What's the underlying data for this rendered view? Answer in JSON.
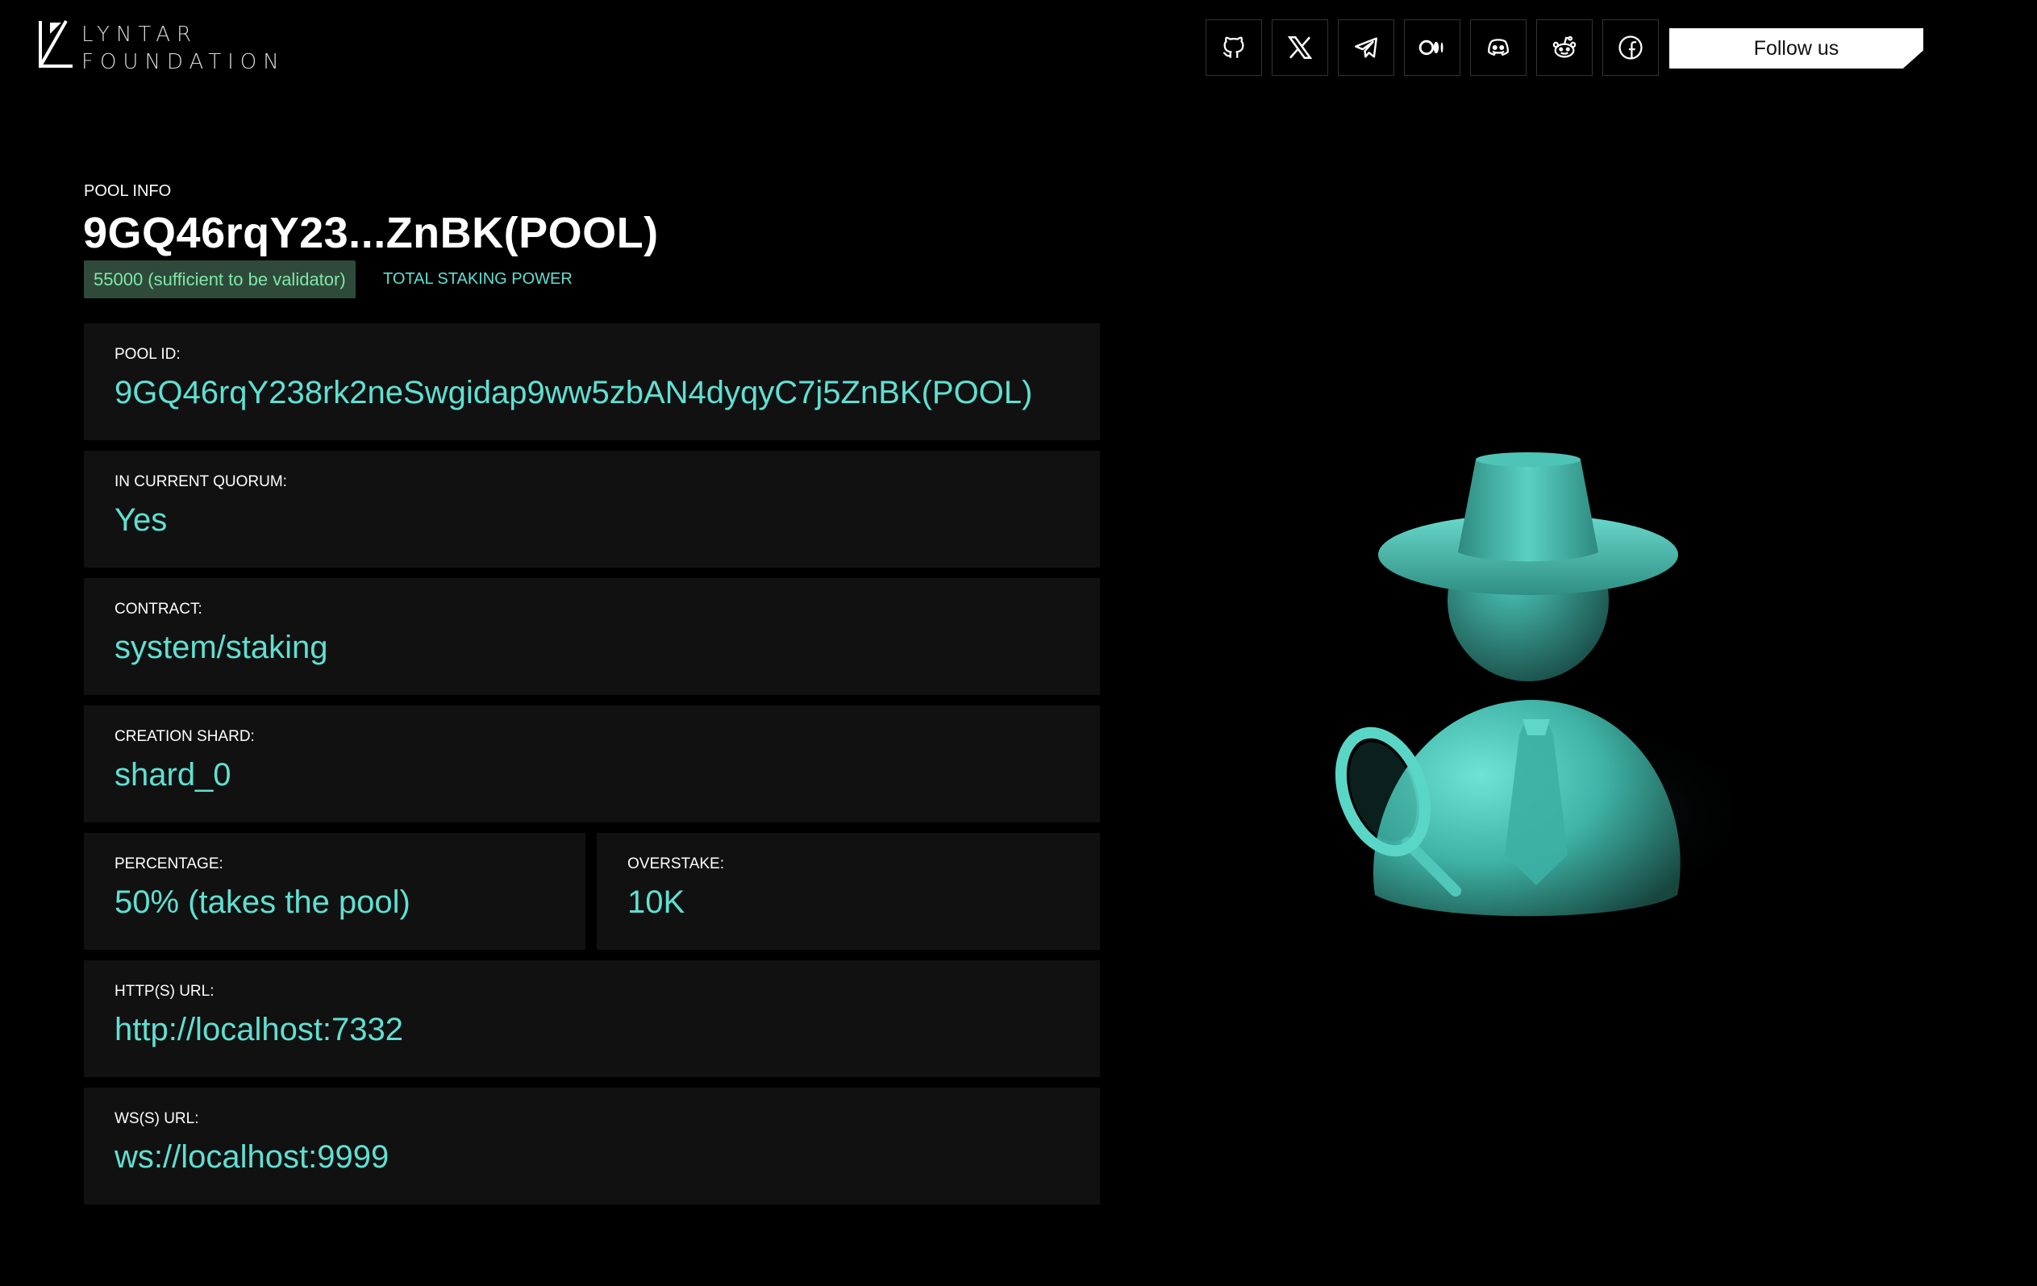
{
  "header": {
    "logo_line1": "LYNTAR",
    "logo_line2": "FOUNDATION",
    "follow_label": "Follow us",
    "socials": [
      "github-icon",
      "x-icon",
      "telegram-icon",
      "medium-icon",
      "discord-icon",
      "reddit-icon",
      "facebook-icon"
    ]
  },
  "pool": {
    "section_label": "POOL INFO",
    "title": "9GQ46rqY23...ZnBK(POOL)",
    "badge": "55000 (sufficient to be validator)",
    "badge_caption": "TOTAL STAKING POWER"
  },
  "fields": {
    "pool_id": {
      "label": "POOL ID:",
      "value": "9GQ46rqY238rk2neSwgidap9ww5zbAN4dyqyC7j5ZnBK(POOL)"
    },
    "quorum": {
      "label": "IN CURRENT QUORUM:",
      "value": "Yes"
    },
    "contract": {
      "label": "CONTRACT:",
      "value": "system/staking"
    },
    "shard": {
      "label": "CREATION SHARD:",
      "value": "shard_0"
    },
    "percentage": {
      "label": "PERCENTAGE:",
      "value": "50% (takes the pool)"
    },
    "overstake": {
      "label": "OVERSTAKE:",
      "value": "10K"
    },
    "http_url": {
      "label": "HTTP(S) URL:",
      "value": "http://localhost:7332"
    },
    "ws_url": {
      "label": "WS(S) URL:",
      "value": "ws://localhost:9999"
    }
  },
  "colors": {
    "accent": "#5fe0d2",
    "badge_bg": "#2f4a3a",
    "badge_text": "#7ee8a8",
    "card_bg": "#111111"
  }
}
